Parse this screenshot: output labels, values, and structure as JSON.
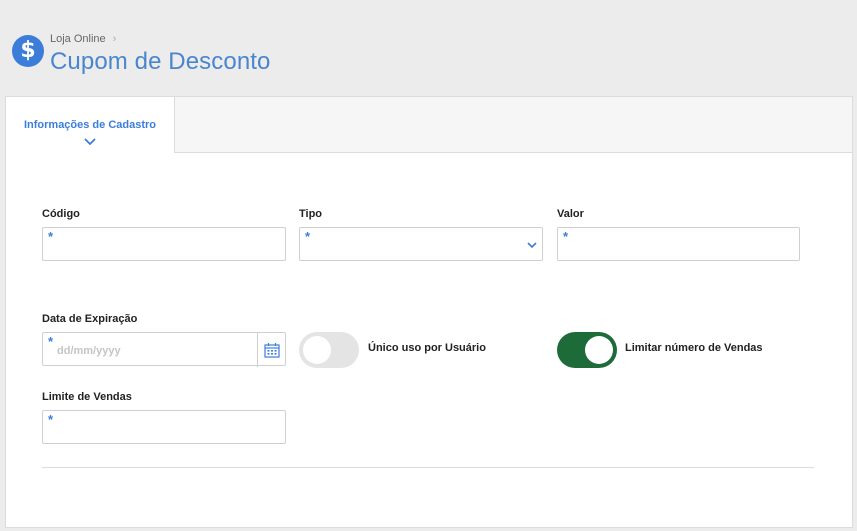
{
  "header": {
    "icon": "dollar-icon",
    "icon_glyph": "$",
    "breadcrumb": "Loja Online",
    "breadcrumb_separator": "›",
    "title": "Cupom de Desconto"
  },
  "tabs": [
    {
      "label": "Informações de Cadastro",
      "active": true,
      "icon": "chevron-down-icon"
    }
  ],
  "form": {
    "codigo": {
      "label": "Código",
      "required_mark": "*",
      "value": ""
    },
    "tipo": {
      "label": "Tipo",
      "required_mark": "*",
      "value": "",
      "icon": "chevron-down-icon"
    },
    "valor": {
      "label": "Valor",
      "required_mark": "*",
      "value": ""
    },
    "data_expiracao": {
      "label": "Data de Expiração",
      "required_mark": "*",
      "placeholder": "dd/mm/yyyy",
      "icon": "calendar-icon"
    },
    "unico_uso": {
      "label": "Único uso por Usuário",
      "checked": false
    },
    "limitar_vendas": {
      "label": "Limitar número de Vendas",
      "checked": true
    },
    "limite_vendas": {
      "label": "Limite de Vendas",
      "required_mark": "*",
      "value": ""
    }
  },
  "colors": {
    "accent": "#3b7dd8",
    "toggle_on": "#1e6b3a",
    "toggle_off": "#e4e4e4"
  }
}
